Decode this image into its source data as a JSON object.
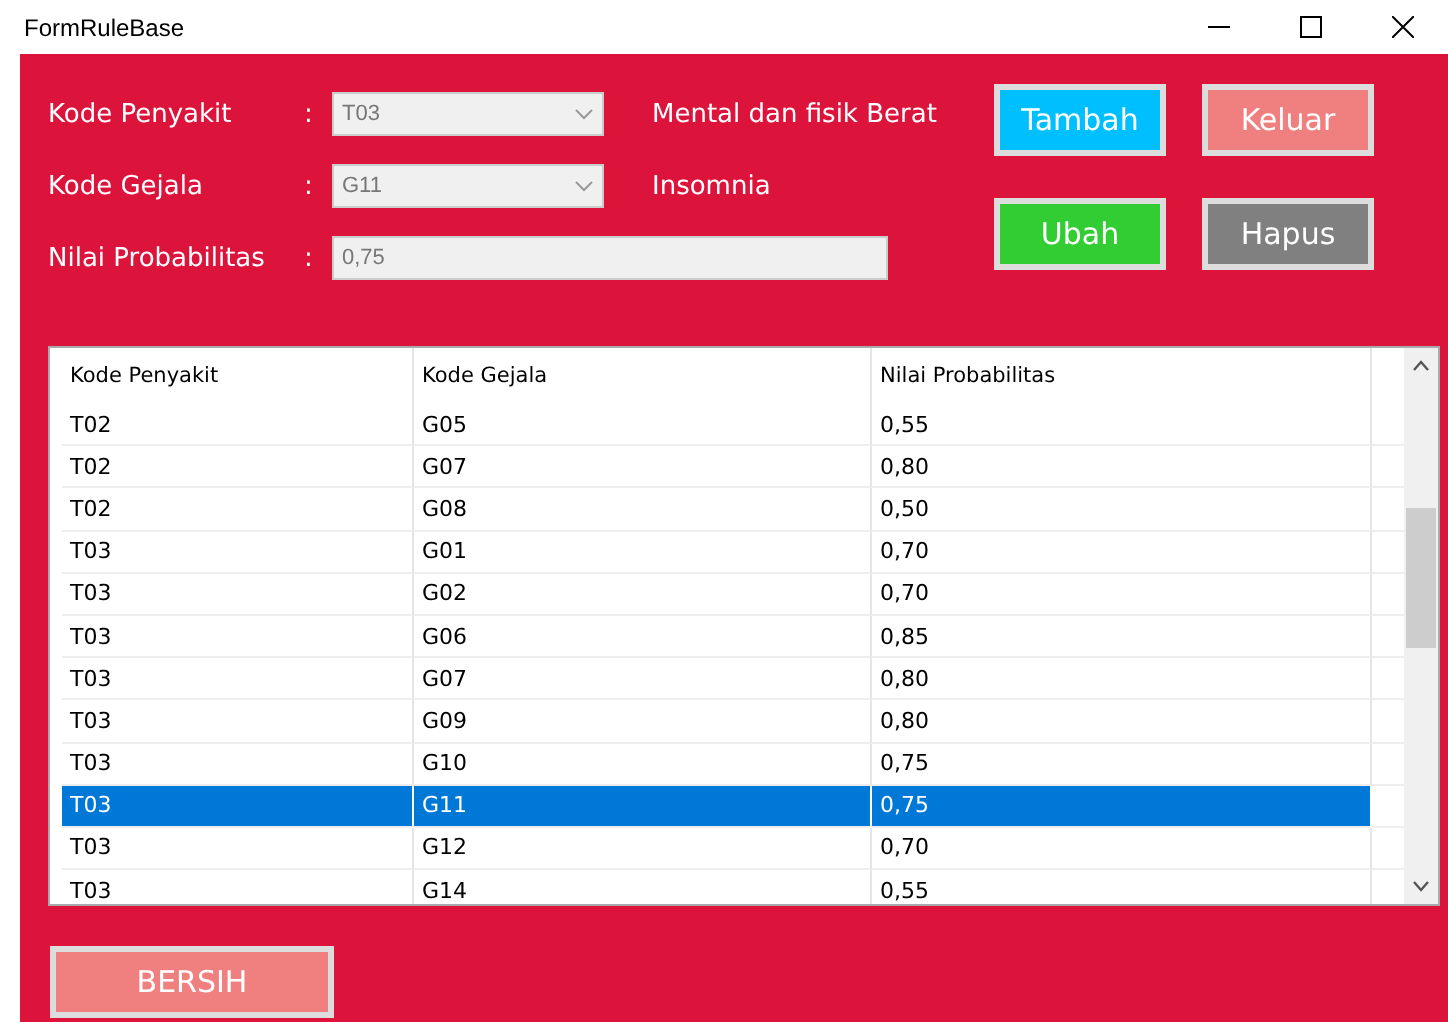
{
  "window": {
    "title": "FormRuleBase"
  },
  "fields": [
    {
      "kind": "combo",
      "label": "Kode Penyakit",
      "separator": ":",
      "value": "T03",
      "description": "Mental dan fisik Berat"
    },
    {
      "kind": "combo",
      "label": "Kode Gejala",
      "separator": ":",
      "value": "G11",
      "description": "Insomnia"
    },
    {
      "kind": "text",
      "label": "Nilai Probabilitas",
      "separator": ":",
      "value": "0,75"
    }
  ],
  "buttons": [
    {
      "label": "Tambah",
      "color": "#00bfff"
    },
    {
      "label": "Keluar",
      "color": "#f08080"
    },
    {
      "label": "Ubah",
      "color": "#32cd32"
    },
    {
      "label": "Hapus",
      "color": "#808080"
    }
  ],
  "table": {
    "columns": [
      "Kode Penyakit",
      "Kode Gejala",
      "Nilai Probabilitas"
    ],
    "rows": [
      {
        "cells": [
          "T02",
          "G05",
          "0,55"
        ],
        "selected": false
      },
      {
        "cells": [
          "T02",
          "G07",
          "0,80"
        ],
        "selected": false
      },
      {
        "cells": [
          "T02",
          "G08",
          "0,50"
        ],
        "selected": false
      },
      {
        "cells": [
          "T03",
          "G01",
          "0,70"
        ],
        "selected": false
      },
      {
        "cells": [
          "T03",
          "G02",
          "0,70"
        ],
        "selected": false
      },
      {
        "cells": [
          "T03",
          "G06",
          "0,85"
        ],
        "selected": false
      },
      {
        "cells": [
          "T03",
          "G07",
          "0,80"
        ],
        "selected": false
      },
      {
        "cells": [
          "T03",
          "G09",
          "0,80"
        ],
        "selected": false
      },
      {
        "cells": [
          "T03",
          "G10",
          "0,75"
        ],
        "selected": false
      },
      {
        "cells": [
          "T03",
          "G11",
          "0,75"
        ],
        "selected": true
      },
      {
        "cells": [
          "T03",
          "G12",
          "0,70"
        ],
        "selected": false
      },
      {
        "cells": [
          "T03",
          "G14",
          "0,55"
        ],
        "selected": false
      }
    ]
  },
  "clear_button": {
    "label": "BERSIH",
    "color": "#f08080"
  }
}
